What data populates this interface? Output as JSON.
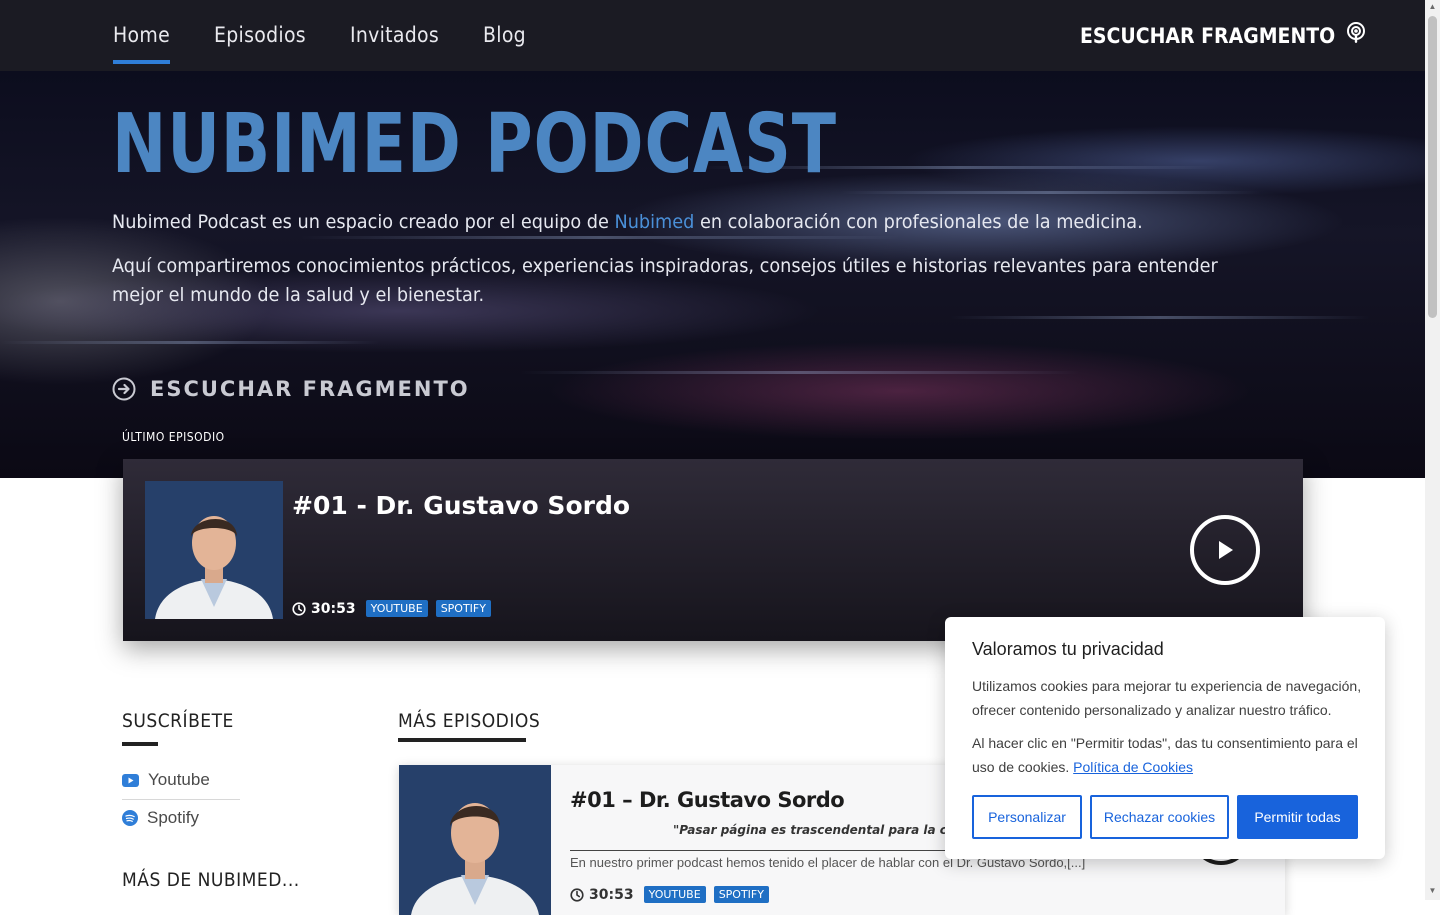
{
  "nav": {
    "items": [
      {
        "label": "Home",
        "active": true
      },
      {
        "label": "Episodios",
        "active": false
      },
      {
        "label": "Invitados",
        "active": false
      },
      {
        "label": "Blog",
        "active": false
      }
    ],
    "listen_label": "ESCUCHAR FRAGMENTO",
    "listen_icon": "podcast-icon"
  },
  "hero": {
    "title": "NUBIMED PODCAST",
    "p1_before": "Nubimed Podcast es un espacio creado por el equipo de ",
    "p1_link": "Nubimed",
    "p1_after": " en colaboración con profesionales de la medicina.",
    "p2": "Aquí compartiremos conocimientos prácticos, experiencias inspiradoras, consejos útiles e historias relevantes para entender mejor el mundo de la salud y el bienestar.",
    "cta_label": "ESCUCHAR FRAGMENTO",
    "cta_icon": "arrow-circle-right-icon",
    "accent_color": "#4c86c2"
  },
  "latest": {
    "label": "ÚLTIMO EPISODIO",
    "title": "#01 - Dr. Gustavo Sordo",
    "duration": "30:53",
    "badges": [
      "YOUTUBE",
      "SPOTIFY"
    ],
    "badge_color": "#1f6fc4"
  },
  "sidebar": {
    "subscribe_title": "SUSCRÍBETE",
    "links": [
      {
        "label": "Youtube",
        "icon": "youtube-icon"
      },
      {
        "label": "Spotify",
        "icon": "spotify-icon"
      }
    ],
    "more_title": "MÁS DE NUBIMED..."
  },
  "episodes": {
    "section_title": "MÁS EPISODIOS",
    "items": [
      {
        "title": "#01 – Dr. Gustavo Sordo",
        "quote": "\"Pasar página es trascendental para la calidad d",
        "description": "En nuestro primer podcast hemos tenido el placer de hablar con el Dr. Gustavo Sordo,[...]",
        "duration": "30:53",
        "badges": [
          "YOUTUBE",
          "SPOTIFY"
        ]
      }
    ]
  },
  "cookie": {
    "title": "Valoramos tu privacidad",
    "text1": "Utilizamos cookies para mejorar tu experiencia de navegación, ofrecer contenido personalizado y analizar nuestro tráfico.",
    "text2_before": "Al hacer clic en \"Permitir todas\", das tu consentimiento para el uso de cookies. ",
    "text2_link": "Política de Cookies",
    "btn_customize": "Personalizar",
    "btn_reject": "Rechazar cookies",
    "btn_accept": "Permitir todas",
    "accent_color": "#1863dc"
  }
}
